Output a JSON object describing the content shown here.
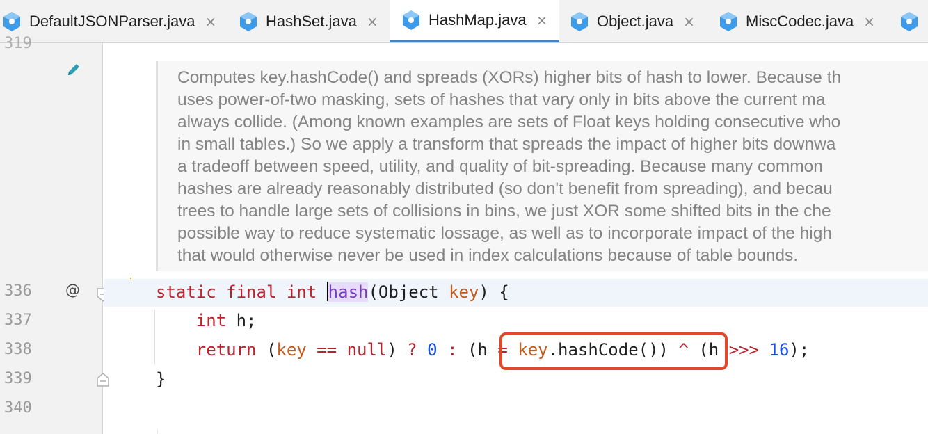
{
  "tabs": [
    {
      "label": "DefaultJSONParser.java",
      "icon": "java-class-icon",
      "close": "×"
    },
    {
      "label": "HashSet.java",
      "icon": "java-class-icon",
      "close": "×"
    },
    {
      "label": "HashMap.java",
      "icon": "java-class-icon",
      "close": "×",
      "active": true
    },
    {
      "label": "Object.java",
      "icon": "java-class-icon",
      "close": "×"
    },
    {
      "label": "MiscCodec.java",
      "icon": "java-class-icon",
      "close": "×"
    }
  ],
  "gutter": {
    "partial_line_number": "319",
    "line_numbers": [
      "336",
      "337",
      "338",
      "339",
      "340"
    ],
    "override_marker": "@",
    "edit_icon": "pencil-icon",
    "intention_icon": "lightbulb-icon",
    "fold_icon": "fold-icon"
  },
  "doc_comment": {
    "lines": [
      "Computes key.hashCode() and spreads (XORs) higher bits of hash to lower. Because th",
      "uses power-of-two masking, sets of hashes that vary only in bits above the current ma",
      "always collide. (Among known examples are sets of Float keys holding consecutive who",
      "in small tables.) So we apply a transform that spreads the impact of higher bits downwa",
      "a tradeoff between speed, utility, and quality of bit-spreading. Because many common",
      "hashes are already reasonably distributed (so don't benefit from spreading), and becau",
      "trees to handle large sets of collisions in bins, we just XOR some shifted bits in the che",
      "possible way to reduce systematic lossage, as well as to incorporate impact of the high",
      "that would otherwise never be used in index calculations because of table bounds."
    ]
  },
  "code": {
    "line336": {
      "kw1": "static",
      "kw2": "final",
      "kw3": "int",
      "method": "hash",
      "rest_open": "(Object ",
      "param": "key",
      "rest_close": ") {"
    },
    "line337": {
      "kw": "int",
      "rest": " h;"
    },
    "line338": {
      "kw_return": "return",
      "open": " (",
      "key1": "key",
      "op_eq": " == ",
      "kw_null": "null",
      "close": ") ",
      "ternary": "?",
      "zero": "0",
      "colon": ":",
      "hl_open": "(h ",
      "hl_eq": "=",
      "hl_key": "key",
      "hl_call": ".hashCode())",
      "caret": "^",
      "paren_h": " (h ",
      "shift": ">>>",
      "sixteen": "16",
      "end": ");"
    },
    "line339": {
      "brace": "}"
    }
  },
  "colors": {
    "keyword": "#b8232c",
    "parameter": "#c45a1c",
    "number": "#1750eb",
    "comment": "#848484",
    "highlight_box": "#e0472b",
    "active_tab_underline": "#4083c9"
  }
}
